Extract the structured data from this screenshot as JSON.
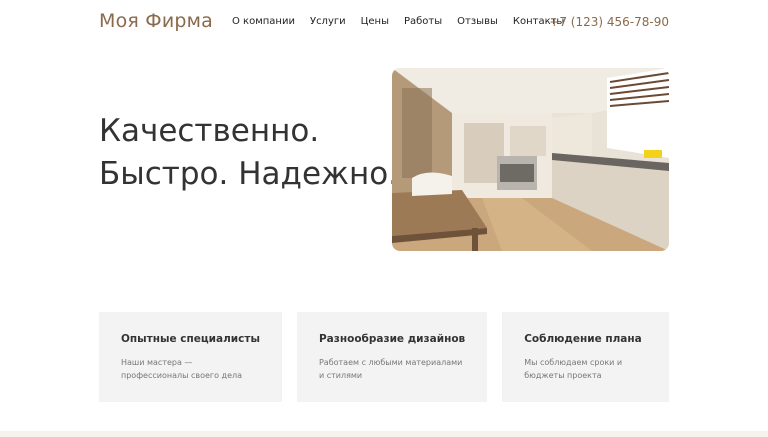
{
  "header": {
    "logo": "Моя Фирма",
    "nav": [
      "О компании",
      "Услуги",
      "Цены",
      "Работы",
      "Отзывы",
      "Контакты"
    ],
    "phone": "+7 (123) 456-78-90"
  },
  "hero": {
    "line1": "Качественно.",
    "line2": "Быстро. Надежно."
  },
  "features": [
    {
      "title": "Опытные специалисты",
      "text": "Наши мастера — профессионалы своего дела"
    },
    {
      "title": "Разнообразие дизайнов",
      "text": "Работаем с любыми материалами и стилями"
    },
    {
      "title": "Соблюдение плана",
      "text": "Мы соблюдаем сроки и бюджеты проекта"
    }
  ],
  "colors": {
    "accent": "#8b6a4c",
    "card_bg": "#f3f3f3",
    "text": "#333333"
  }
}
